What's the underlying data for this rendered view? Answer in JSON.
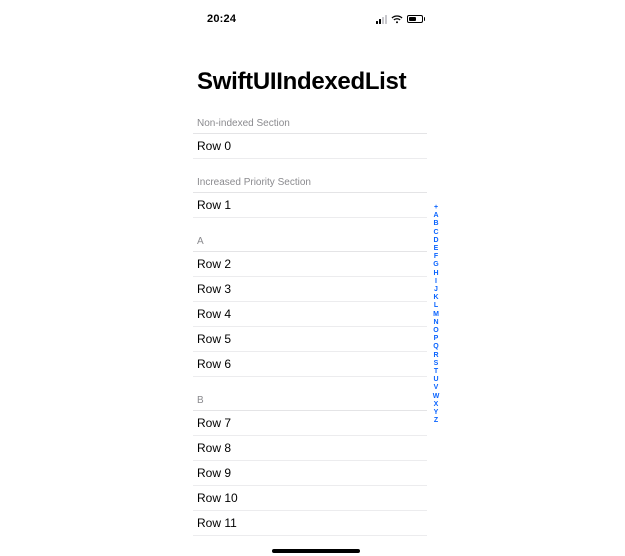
{
  "statusBar": {
    "time": "20:24"
  },
  "title": "SwiftUIIndexedList",
  "sections": [
    {
      "header": "Non-indexed Section",
      "rows": [
        "Row 0"
      ]
    },
    {
      "header": "Increased Priority Section",
      "rows": [
        "Row 1"
      ]
    },
    {
      "header": "A",
      "rows": [
        "Row 2",
        "Row 3",
        "Row 4",
        "Row 5",
        "Row 6"
      ]
    },
    {
      "header": "B",
      "rows": [
        "Row 7",
        "Row 8",
        "Row 9",
        "Row 10",
        "Row 11"
      ]
    }
  ],
  "indexBar": [
    "+",
    "A",
    "B",
    "C",
    "D",
    "E",
    "F",
    "G",
    "H",
    "I",
    "J",
    "K",
    "L",
    "M",
    "N",
    "O",
    "P",
    "Q",
    "R",
    "S",
    "T",
    "U",
    "V",
    "W",
    "X",
    "Y",
    "Z"
  ]
}
